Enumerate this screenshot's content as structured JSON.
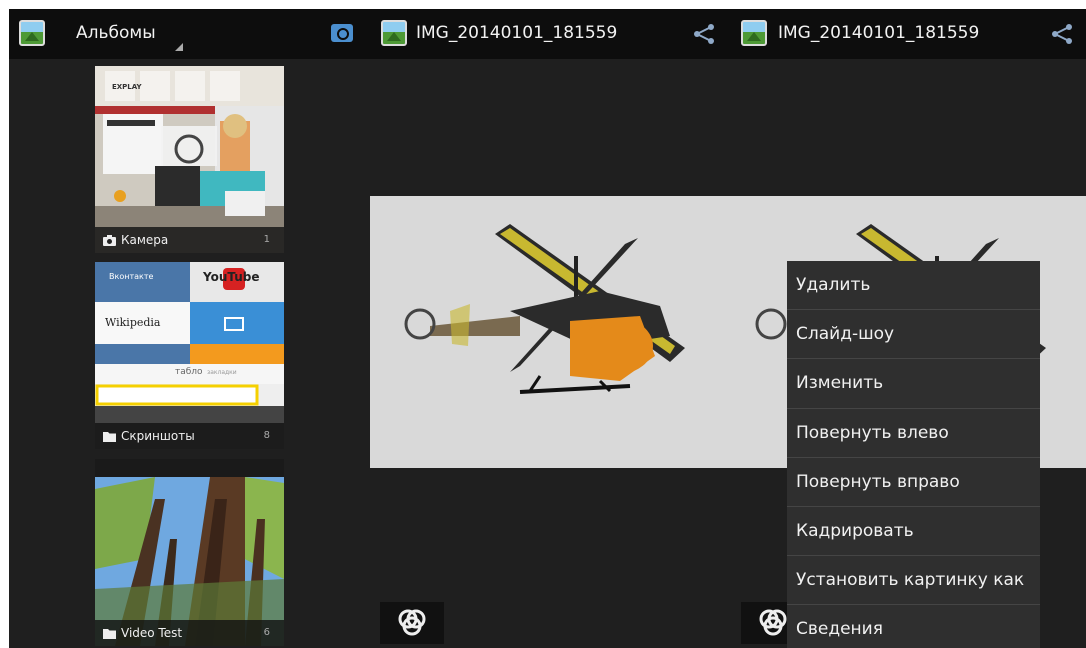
{
  "albums_panel": {
    "title": "Альбомы",
    "albums": [
      {
        "name": "Камера",
        "count": "1"
      },
      {
        "name": "Скриншоты",
        "count": "8"
      },
      {
        "name": "Video Test",
        "count": "6"
      }
    ],
    "screenshot_thumb": {
      "vk": "Вконтакте",
      "youtube": "YouTube",
      "wikipedia": "Wikipedia",
      "tablo": "табло",
      "bookmarks": "закладки"
    },
    "camera_thumb": {
      "brand": "EXPLAY"
    }
  },
  "photo_panel": {
    "title": "IMG_20140101_181559"
  },
  "menu_panel": {
    "title": "IMG_20140101_181559",
    "menu_items": [
      "Удалить",
      "Слайд-шоу",
      "Изменить",
      "Повернуть влево",
      "Повернуть вправо",
      "Кадрировать",
      "Установить картинку как",
      "Сведения"
    ]
  },
  "colors": {
    "actionbar": "#0d0d0d",
    "background": "#1f1f1f",
    "menu": "#2f2f2f",
    "accent": "#4b8fcf"
  }
}
